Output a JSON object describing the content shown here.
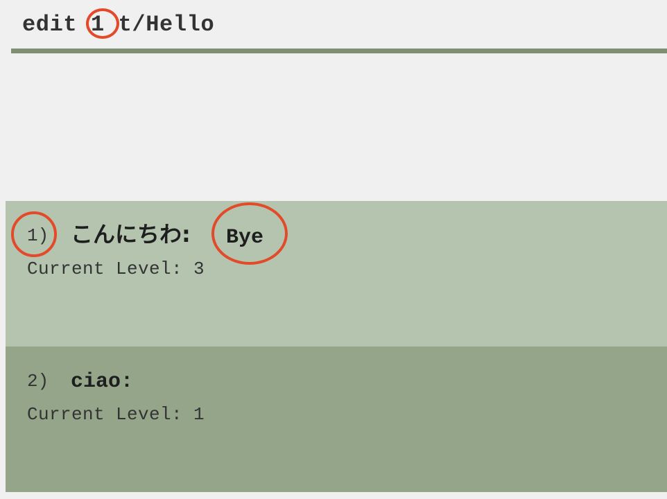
{
  "command_box": {
    "text": "edit 1 t/Hello"
  },
  "result_display": {
    "text": ""
  },
  "flashcards": [
    {
      "index": "1)",
      "question": "こんにちわ:",
      "answer": "Bye",
      "level": "Current Level: 3"
    },
    {
      "index": "2)",
      "question": "ciao:",
      "answer": "",
      "level": "Current Level: 1"
    }
  ],
  "colors": {
    "background": "#f0f0f0",
    "divider": "#808f73",
    "card_selected": "#b4c4af",
    "card_default": "#95a58a",
    "annotation": "#e24a2a"
  }
}
